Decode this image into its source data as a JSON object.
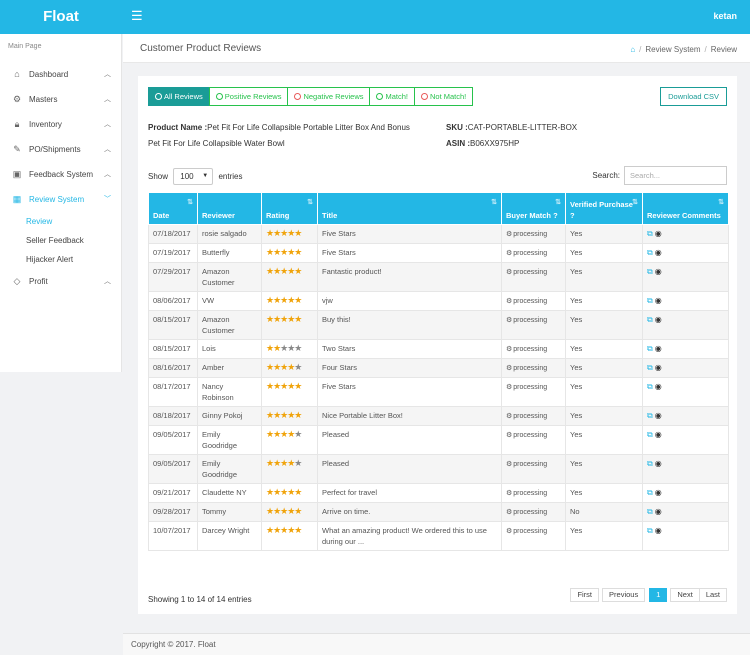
{
  "header": {
    "brand": "Float",
    "menu_icon": "hamburger-icon",
    "user": "ketan"
  },
  "sidebar": {
    "heading": "Main Page",
    "items": [
      {
        "label": "Dashboard",
        "icon": "home-icon"
      },
      {
        "label": "Masters",
        "icon": "gear-icon"
      },
      {
        "label": "Inventory",
        "icon": "lock-icon"
      },
      {
        "label": "PO/Shipments",
        "icon": "wrench-icon"
      },
      {
        "label": "Feedback System",
        "icon": "car-icon"
      },
      {
        "label": "Review System",
        "icon": "grid-icon"
      },
      {
        "label": "Profit",
        "icon": "diamond-icon"
      }
    ],
    "subitems": [
      {
        "label": "Review"
      },
      {
        "label": "Seller Feedback"
      },
      {
        "label": "Hijacker Alert"
      }
    ]
  },
  "page": {
    "title": "Customer Product Reviews",
    "breadcrumb": [
      "Review System",
      "Review"
    ]
  },
  "filters": {
    "all": "All Reviews",
    "positive": "Positive Reviews",
    "negative": "Negative Reviews",
    "match": "Match!",
    "not_match": "Not Match!",
    "download": "Download CSV"
  },
  "product": {
    "name_label": "Product Name :",
    "name_line1": "Pet Fit For Life Collapsible Portable Litter Box And Bonus",
    "name_line2": "Pet Fit For Life Collapsible Water Bowl",
    "sku_label": "SKU :",
    "sku": "CAT-PORTABLE-LITTER-BOX",
    "asin_label": "ASIN :",
    "asin": "B06XX975HP"
  },
  "table_controls": {
    "show_label": "Show",
    "entries_label": "entries",
    "page_size": "100",
    "search_label": "Search:",
    "search_placeholder": "Search..."
  },
  "table": {
    "headers": [
      "Date",
      "Reviewer",
      "Rating",
      "Title",
      "Buyer Match ?",
      "Verified Purchase ?",
      "Reviewer Comments"
    ],
    "rows": [
      {
        "date": "07/18/2017",
        "reviewer": "rosie salgado",
        "rating": 5,
        "title": "Five Stars",
        "match": "processing",
        "verified": "Yes"
      },
      {
        "date": "07/19/2017",
        "reviewer": "Butterfly",
        "rating": 5,
        "title": "Five Stars",
        "match": "processing",
        "verified": "Yes"
      },
      {
        "date": "07/29/2017",
        "reviewer": "Amazon Customer",
        "rating": 5,
        "title": "Fantastic product!",
        "match": "processing",
        "verified": "Yes"
      },
      {
        "date": "08/06/2017",
        "reviewer": "VW",
        "rating": 5,
        "title": "vjw",
        "match": "processing",
        "verified": "Yes"
      },
      {
        "date": "08/15/2017",
        "reviewer": "Amazon Customer",
        "rating": 5,
        "title": "Buy this!",
        "match": "processing",
        "verified": "Yes"
      },
      {
        "date": "08/15/2017",
        "reviewer": "Lois",
        "rating": 2,
        "title": "Two Stars",
        "match": "processing",
        "verified": "Yes"
      },
      {
        "date": "08/16/2017",
        "reviewer": "Amber",
        "rating": 4,
        "title": "Four Stars",
        "match": "processing",
        "verified": "Yes"
      },
      {
        "date": "08/17/2017",
        "reviewer": "Nancy Robinson",
        "rating": 5,
        "title": "Five Stars",
        "match": "processing",
        "verified": "Yes"
      },
      {
        "date": "08/18/2017",
        "reviewer": "Ginny Pokoj",
        "rating": 5,
        "title": "Nice Portable Litter Box!",
        "match": "processing",
        "verified": "Yes"
      },
      {
        "date": "09/05/2017",
        "reviewer": "Emily Goodridge",
        "rating": 4,
        "title": "Pleased",
        "match": "processing",
        "verified": "Yes"
      },
      {
        "date": "09/05/2017",
        "reviewer": "Emily Goodridge",
        "rating": 4,
        "title": "Pleased",
        "match": "processing",
        "verified": "Yes"
      },
      {
        "date": "09/21/2017",
        "reviewer": "Claudette NY",
        "rating": 5,
        "title": "Perfect for travel",
        "match": "processing",
        "verified": "Yes"
      },
      {
        "date": "09/28/2017",
        "reviewer": "Tommy",
        "rating": 5,
        "title": "Arrive on time.",
        "match": "processing",
        "verified": "No"
      },
      {
        "date": "10/07/2017",
        "reviewer": "Darcey Wright",
        "rating": 5,
        "title": "What an amazing product! We ordered this to use during our ...",
        "match": "processing",
        "verified": "Yes"
      }
    ]
  },
  "pagination": {
    "info": "Showing 1 to 14 of 14 entries",
    "first": "First",
    "previous": "Previous",
    "current": "1",
    "next": "Next",
    "last": "Last"
  },
  "footer": {
    "copyright": "Copyright © 2017. Float"
  },
  "colors": {
    "primary": "#23b7e5",
    "active_filter": "#1a9c97",
    "filter_border": "#27c24c",
    "star": "#f0a30a"
  }
}
